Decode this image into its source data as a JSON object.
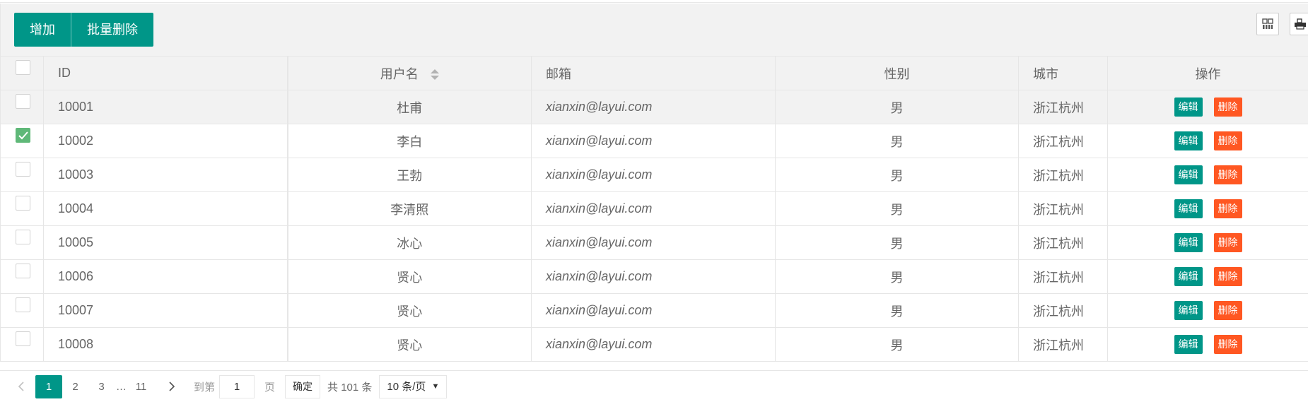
{
  "toolbar": {
    "add_label": "增加",
    "batch_delete_label": "批量删除",
    "icons": [
      "columns-icon",
      "print-icon"
    ]
  },
  "table": {
    "headers": {
      "id": "ID",
      "username": "用户名",
      "email": "邮箱",
      "gender": "性别",
      "city": "城市",
      "ops": "操作"
    },
    "edit_label": "编辑",
    "delete_label": "删除",
    "rows": [
      {
        "checked": false,
        "id": "10001",
        "username": "杜甫",
        "email": "xianxin@layui.com",
        "gender": "男",
        "city": "浙江杭州"
      },
      {
        "checked": true,
        "id": "10002",
        "username": "李白",
        "email": "xianxin@layui.com",
        "gender": "男",
        "city": "浙江杭州"
      },
      {
        "checked": false,
        "id": "10003",
        "username": "王勃",
        "email": "xianxin@layui.com",
        "gender": "男",
        "city": "浙江杭州"
      },
      {
        "checked": false,
        "id": "10004",
        "username": "李清照",
        "email": "xianxin@layui.com",
        "gender": "男",
        "city": "浙江杭州"
      },
      {
        "checked": false,
        "id": "10005",
        "username": "冰心",
        "email": "xianxin@layui.com",
        "gender": "男",
        "city": "浙江杭州"
      },
      {
        "checked": false,
        "id": "10006",
        "username": "贤心",
        "email": "xianxin@layui.com",
        "gender": "男",
        "city": "浙江杭州"
      },
      {
        "checked": false,
        "id": "10007",
        "username": "贤心",
        "email": "xianxin@layui.com",
        "gender": "男",
        "city": "浙江杭州"
      },
      {
        "checked": false,
        "id": "10008",
        "username": "贤心",
        "email": "xianxin@layui.com",
        "gender": "男",
        "city": "浙江杭州"
      }
    ]
  },
  "pager": {
    "pages": [
      "1",
      "2",
      "3"
    ],
    "ellipsis": "…",
    "last_page": "11",
    "goto_label": "到第",
    "goto_value": "1",
    "page_unit": "页",
    "confirm_label": "确定",
    "total_text": "共 101 条",
    "page_size": "10 条/页"
  },
  "colors": {
    "primary": "#009688",
    "danger": "#ff5722",
    "checked": "#5fb878"
  }
}
